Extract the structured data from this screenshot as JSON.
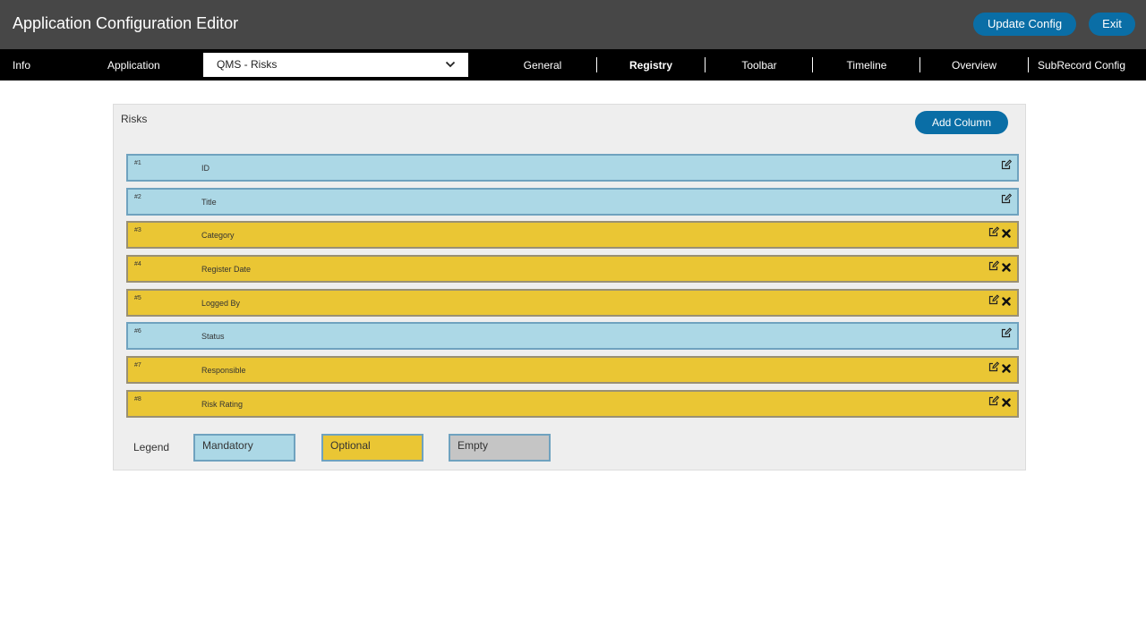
{
  "app": {
    "title": "Application Configuration Editor",
    "update_label": "Update Config",
    "exit_label": "Exit"
  },
  "nav": {
    "info_label": "Info",
    "application_label": "Application",
    "selected_application": "QMS - Risks",
    "tabs": [
      "General",
      "Registry",
      "Toolbar",
      "Timeline",
      "Overview",
      "SubRecord Config"
    ],
    "active_tab": "Registry"
  },
  "panel": {
    "title": "Risks",
    "add_column_label": "Add Column",
    "columns": [
      {
        "num": "#1",
        "label": "ID",
        "kind": "mandatory"
      },
      {
        "num": "#2",
        "label": "Title",
        "kind": "mandatory"
      },
      {
        "num": "#3",
        "label": "Category",
        "kind": "optional"
      },
      {
        "num": "#4",
        "label": "Register Date",
        "kind": "optional"
      },
      {
        "num": "#5",
        "label": "Logged By",
        "kind": "optional"
      },
      {
        "num": "#6",
        "label": "Status",
        "kind": "mandatory"
      },
      {
        "num": "#7",
        "label": "Responsible",
        "kind": "optional"
      },
      {
        "num": "#8",
        "label": "Risk Rating",
        "kind": "optional"
      }
    ]
  },
  "legend": {
    "label": "Legend",
    "mandatory": "Mandatory",
    "optional": "Optional",
    "empty": "Empty"
  },
  "colors": {
    "mandatory": "#acd8e6",
    "optional": "#eac634",
    "empty": "#c5c5c5",
    "accent": "#0a6ea6"
  }
}
